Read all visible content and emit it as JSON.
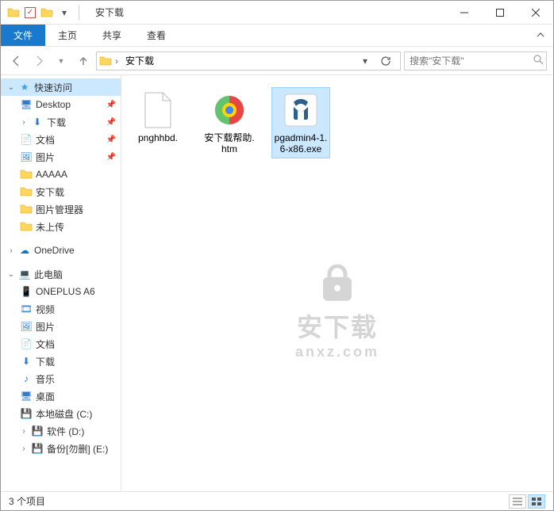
{
  "window": {
    "title": "安下载"
  },
  "ribbon": {
    "file": "文件",
    "tabs": [
      "主页",
      "共享",
      "查看"
    ]
  },
  "nav": {
    "path_segments": [
      "安下载"
    ],
    "search_placeholder": "搜索\"安下载\""
  },
  "sidebar": {
    "quick_access": "快速访问",
    "quick_items": [
      "Desktop",
      "下载",
      "文档",
      "图片",
      "AAAAA",
      "安下载",
      "图片管理器",
      "未上传"
    ],
    "onedrive": "OneDrive",
    "this_pc": "此电脑",
    "pc_items": [
      "ONEPLUS A6",
      "视频",
      "图片",
      "文档",
      "下载",
      "音乐",
      "桌面",
      "本地磁盘 (C:)",
      "软件 (D:)",
      "备份[勿删] (E:)"
    ]
  },
  "files": [
    {
      "name": "pnghhbd."
    },
    {
      "name": "安下载帮助.htm"
    },
    {
      "name": "pgadmin4-1.6-x86.exe"
    }
  ],
  "status": {
    "count_text": "3 个项目"
  },
  "watermark": {
    "main": "安下载",
    "sub": "anxz.com"
  }
}
